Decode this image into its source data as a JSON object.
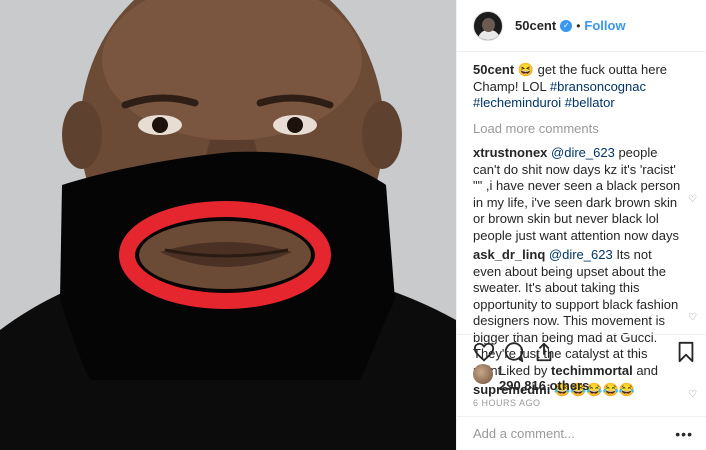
{
  "header": {
    "username": "50cent",
    "separator": "•",
    "follow_label": "Follow"
  },
  "caption": {
    "username": "50cent",
    "emoji": "😆",
    "text": "get the fuck outta here Champ! LOL",
    "hashtags": [
      "#bransoncognac",
      "#lecheminduroi",
      "#bellator"
    ]
  },
  "load_more_label": "Load more comments",
  "comments": [
    {
      "username": "xtrustnonex",
      "mention": "@dire_623",
      "text": "people can't do shit now days kz it's 'racist' \"\" ,i have never seen a black person in my life, i've seen dark brown skin or brown skin but never black lol people just want attention now days"
    },
    {
      "username": "ask_dr_linq",
      "mention": "@dire_623",
      "text": "Its not even about being upset about the sweater. It's about taking this opportunity to support black fashion designers now. This movement is bigger than being mad at Gucci. They're just the catalyst at this point."
    },
    {
      "username": "supremedmi",
      "mention": "",
      "text": "😂😂😂😂😂"
    }
  ],
  "likes": {
    "prefix": "Liked by",
    "user": "techimmortal",
    "conj": "and",
    "count": "290,816 others"
  },
  "time_ago": "6 HOURS AGO",
  "add_comment": {
    "placeholder": "Add a comment..."
  },
  "more_label": "•••",
  "icons": {
    "like": "heart-icon",
    "comment": "comment-icon",
    "share": "share-icon",
    "save": "bookmark-icon",
    "comment_like": "small-heart-icon",
    "verified": "verified-badge-icon"
  },
  "colors": {
    "link": "#3897f0",
    "hashtag": "#003569",
    "muted": "#999999"
  }
}
